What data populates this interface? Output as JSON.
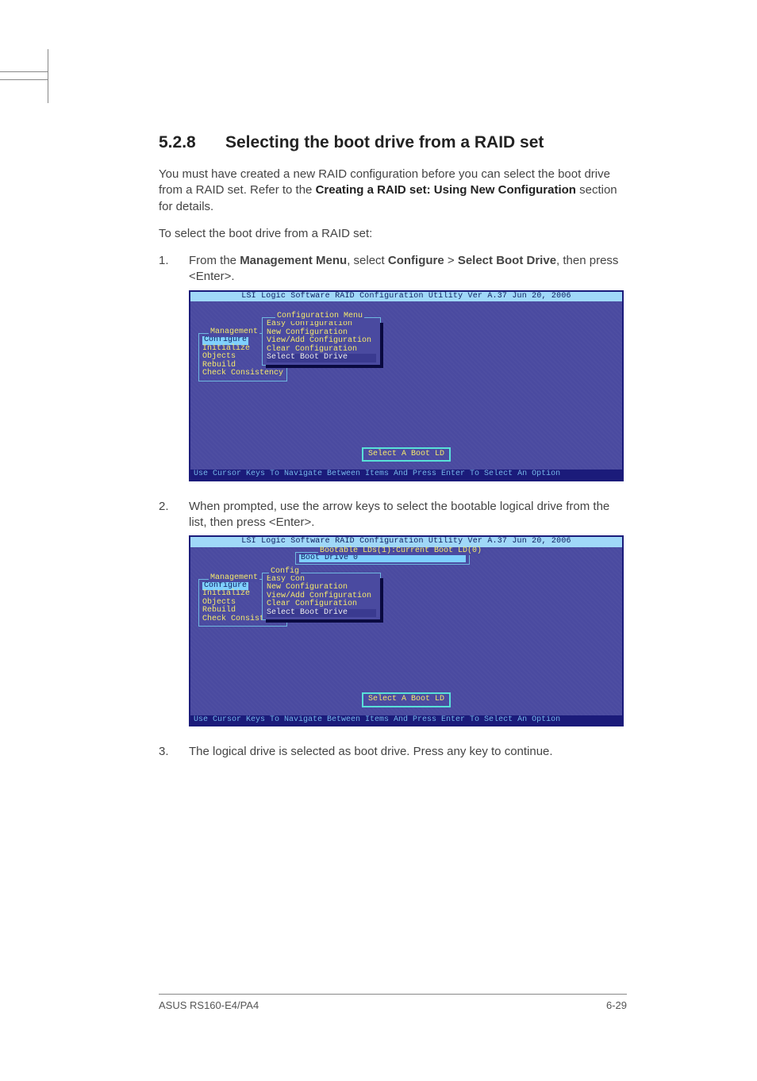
{
  "heading": {
    "num": "5.2.8",
    "title": "Selecting the boot drive from a RAID set"
  },
  "intro": {
    "p1_a": "You must have created a new RAID configuration before you can select the boot drive from a RAID set. Refer to the ",
    "p1_b": "Creating a RAID set: Using New Configuration",
    "p1_c": " section for details.",
    "p2": "To select the boot drive from a RAID set:"
  },
  "steps": {
    "s1": {
      "num": "1.",
      "a": "From the ",
      "b": "Management Menu",
      "c": ", select ",
      "d": "Configure",
      "e": " > ",
      "f": "Select Boot Drive",
      "g": ", then press <Enter>."
    },
    "s2": {
      "num": "2.",
      "text": "When prompted, use the arrow keys to select the bootable logical drive from the list, then press <Enter>."
    },
    "s3": {
      "num": "3.",
      "text": "The logical drive is selected as boot drive. Press any key to continue."
    }
  },
  "bios": {
    "title": "LSI Logic Software RAID Configuration Utility Ver A.37 Jun 20, 2006",
    "footer": "Use Cursor Keys To Navigate Between Items And Press Enter To Select An Option",
    "mgmt": {
      "title": "Management",
      "items": [
        "Configure",
        "Initialize",
        "Objects",
        "Rebuild",
        "Check Consistency"
      ]
    },
    "cfg": {
      "title": "Configuration Menu",
      "items": [
        "Easy Configuration",
        "New Configuration",
        "View/Add Configuration",
        "Clear Configuration",
        "Select Boot Drive"
      ]
    },
    "cfg2": {
      "title_short": "Config",
      "easy_short": "Easy Con"
    },
    "select_boot": "Select A Boot LD",
    "ld": {
      "title": "Bootable LDs(1):Current Boot LD(0)",
      "item": "Boot Drive 0"
    }
  },
  "footer": {
    "left": "ASUS RS160-E4/PA4",
    "right": "6-29"
  }
}
